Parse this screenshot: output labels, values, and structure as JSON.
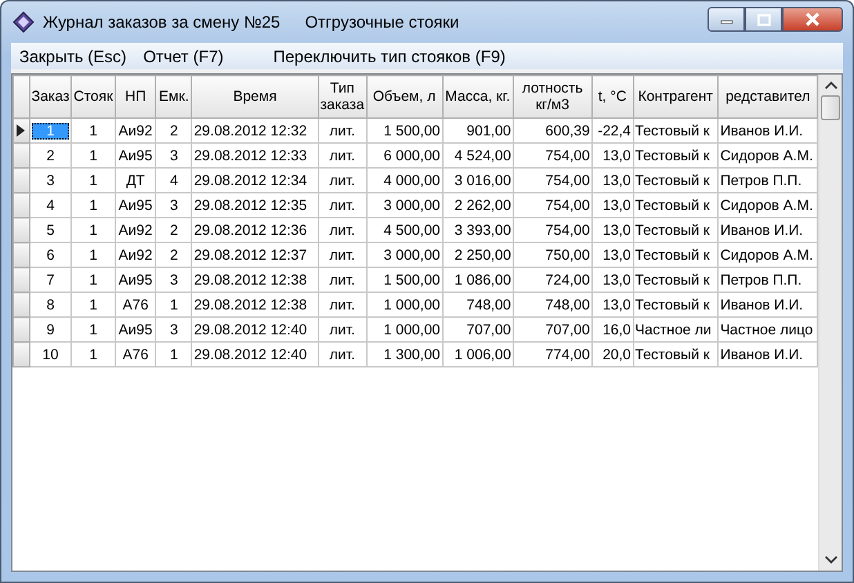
{
  "window": {
    "title": "Журнал заказов за смену №25",
    "subtitle": "Отгрузочные стояки"
  },
  "menu": [
    "Закрыть (Esc)",
    "Отчет (F7)",
    "Переключить тип стояков (F9)"
  ],
  "table": {
    "columns": [
      "Заказ",
      "Стояк",
      "НП",
      "Емк.",
      "Время",
      "Тип заказа",
      "Объем, л",
      "Масса, кг.",
      "лотность кг/м3",
      "t, °C",
      "Контрагент",
      "редставител"
    ],
    "rows": [
      {
        "selected": true,
        "cells": [
          "1",
          "1",
          "Аи92",
          "2",
          "29.08.2012 12:32",
          "лит.",
          "1 500,00",
          "901,00",
          "600,39",
          "-22,4",
          "Тестовый к",
          "Иванов И.И."
        ]
      },
      {
        "selected": false,
        "cells": [
          "2",
          "1",
          "Аи95",
          "3",
          "29.08.2012 12:33",
          "лит.",
          "6 000,00",
          "4 524,00",
          "754,00",
          "13,0",
          "Тестовый к",
          "Сидоров А.М."
        ]
      },
      {
        "selected": false,
        "cells": [
          "3",
          "1",
          "ДТ",
          "4",
          "29.08.2012 12:34",
          "лит.",
          "4 000,00",
          "3 016,00",
          "754,00",
          "13,0",
          "Тестовый к",
          "Петров П.П."
        ]
      },
      {
        "selected": false,
        "cells": [
          "4",
          "1",
          "Аи95",
          "3",
          "29.08.2012 12:35",
          "лит.",
          "3 000,00",
          "2 262,00",
          "754,00",
          "13,0",
          "Тестовый к",
          "Сидоров А.М."
        ]
      },
      {
        "selected": false,
        "cells": [
          "5",
          "1",
          "Аи92",
          "2",
          "29.08.2012 12:36",
          "лит.",
          "4 500,00",
          "3 393,00",
          "754,00",
          "13,0",
          "Тестовый к",
          "Иванов И.И."
        ]
      },
      {
        "selected": false,
        "cells": [
          "6",
          "1",
          "Аи92",
          "2",
          "29.08.2012 12:37",
          "лит.",
          "3 000,00",
          "2 250,00",
          "750,00",
          "13,0",
          "Тестовый к",
          "Сидоров А.М."
        ]
      },
      {
        "selected": false,
        "cells": [
          "7",
          "1",
          "Аи95",
          "3",
          "29.08.2012 12:38",
          "лит.",
          "1 500,00",
          "1 086,00",
          "724,00",
          "13,0",
          "Тестовый к",
          "Петров П.П."
        ]
      },
      {
        "selected": false,
        "cells": [
          "8",
          "1",
          "А76",
          "1",
          "29.08.2012 12:38",
          "лит.",
          "1 000,00",
          "748,00",
          "748,00",
          "13,0",
          "Тестовый к",
          "Иванов И.И."
        ]
      },
      {
        "selected": false,
        "cells": [
          "9",
          "1",
          "Аи95",
          "3",
          "29.08.2012 12:40",
          "лит.",
          "1 000,00",
          "707,00",
          "707,00",
          "16,0",
          "Частное ли",
          "Частное лицо"
        ]
      },
      {
        "selected": false,
        "cells": [
          "10",
          "1",
          "А76",
          "1",
          "29.08.2012 12:40",
          "лит.",
          "1 300,00",
          "1 006,00",
          "774,00",
          "20,0",
          "Тестовый к",
          "Иванов И.И."
        ]
      }
    ]
  }
}
